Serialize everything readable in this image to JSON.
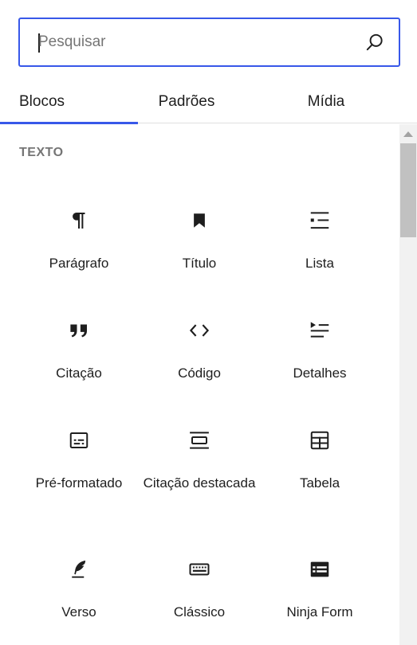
{
  "search": {
    "placeholder": "Pesquisar"
  },
  "tabs": [
    {
      "label": "Blocos",
      "active": true
    },
    {
      "label": "Padrões",
      "active": false
    },
    {
      "label": "Mídia",
      "active": false
    }
  ],
  "section": {
    "title": "TEXTO"
  },
  "blocks": [
    {
      "label": "Parágrafo",
      "icon": "paragraph-icon"
    },
    {
      "label": "Título",
      "icon": "bookmark-heading-icon"
    },
    {
      "label": "Lista",
      "icon": "list-icon"
    },
    {
      "label": "Citação",
      "icon": "quote-icon"
    },
    {
      "label": "Código",
      "icon": "code-icon"
    },
    {
      "label": "Detalhes",
      "icon": "details-icon"
    },
    {
      "label": "Pré-formatado",
      "icon": "preformatted-icon"
    },
    {
      "label": "Citação destacada",
      "icon": "pullquote-icon"
    },
    {
      "label": "Tabela",
      "icon": "table-icon"
    },
    {
      "label": "Verso",
      "icon": "verse-icon"
    },
    {
      "label": "Clássico",
      "icon": "keyboard-icon"
    },
    {
      "label": "Ninja Form",
      "icon": "ninja-form-icon"
    }
  ],
  "colors": {
    "accent": "#3858e9",
    "text": "#1e1e1e",
    "muted": "#757575"
  }
}
